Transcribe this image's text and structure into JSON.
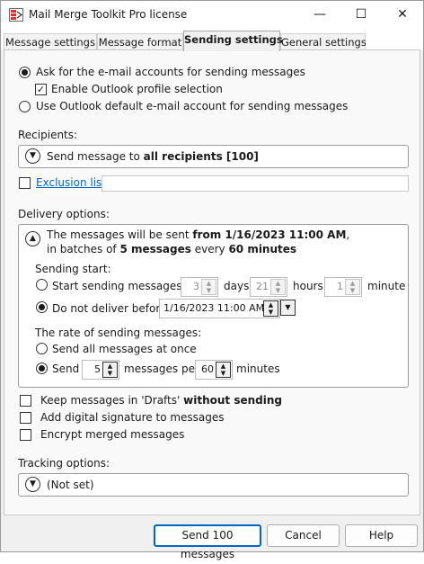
{
  "window": {
    "title": "Mail Merge Toolkit Pro license",
    "minimize": "—",
    "maximize": "☐",
    "close": "✕"
  },
  "tabs": [
    {
      "label": "Message settings"
    },
    {
      "label": "Message format"
    },
    {
      "label": "Sending settings"
    },
    {
      "label": "General settings"
    }
  ],
  "accounts": {
    "ask_label": "Ask for the e-mail accounts for sending messages",
    "enable_profile_label": "Enable Outlook profile selection",
    "use_default_label": "Use Outlook default e-mail account for sending messages"
  },
  "recipients": {
    "heading": "Recipients:",
    "summary_prefix": "Send message to ",
    "summary_bold": "all recipients [100]",
    "exclusion_label": "Exclusion list",
    "exclusion_value": ""
  },
  "delivery": {
    "heading": "Delivery options:",
    "line1_prefix": "The messages will be sent ",
    "line1_bold": "from 1/16/2023 11:00 AM",
    "line1_suffix": ",",
    "line2_prefix": "in batches of ",
    "line2_bold1": "5 messages",
    "line2_mid": " every ",
    "line2_bold2": "60 minutes",
    "sending_start_heading": "Sending start:",
    "start_in_label": "Start sending messages in",
    "days_value": "3",
    "days_label": "days",
    "hours_value": "21",
    "hours_label": "hours",
    "minute_value": "1",
    "minute_label": "minute",
    "not_before_label": "Do not deliver before",
    "not_before_value": "1/16/2023 11:00 AM",
    "rate_heading": "The rate of sending messages:",
    "send_all_label": "Send all messages at once",
    "send_label": "Send",
    "batch_value": "5",
    "messages_per_label": "messages per",
    "interval_value": "60",
    "minutes_label": "minutes"
  },
  "options": {
    "drafts_prefix": "Keep messages in 'Drafts' ",
    "drafts_bold": "without sending",
    "signature_label": "Add digital signature to messages",
    "encrypt_label": "Encrypt merged messages"
  },
  "tracking": {
    "heading": "Tracking options:",
    "value": "(Not set)"
  },
  "buttons": {
    "send": "Send 100 messages",
    "cancel": "Cancel",
    "help": "Help"
  }
}
